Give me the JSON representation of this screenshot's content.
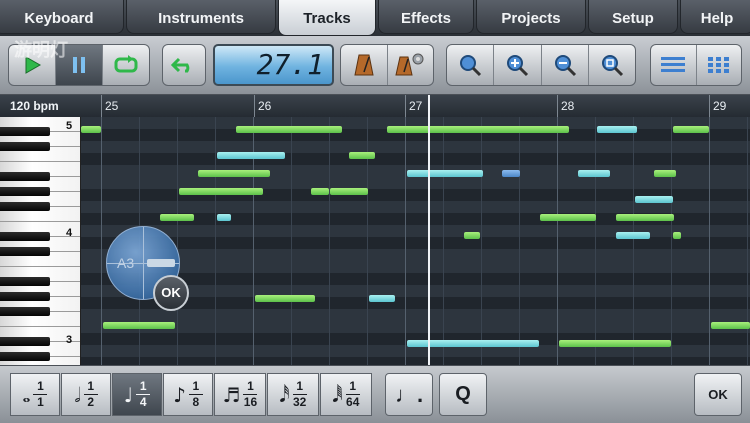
{
  "tabs": [
    {
      "label": "Keyboard",
      "active": false
    },
    {
      "label": "Instruments",
      "active": false
    },
    {
      "label": "Tracks",
      "active": true
    },
    {
      "label": "Effects",
      "active": false
    },
    {
      "label": "Projects",
      "active": false
    },
    {
      "label": "Setup",
      "active": false
    },
    {
      "label": "Help",
      "active": false
    }
  ],
  "watermark": "游明灯",
  "toolbar": {
    "transport": {
      "play_icon": "play-icon",
      "pause_icon": "pause-icon",
      "loop_icon": "loop-icon",
      "active": "pause"
    },
    "undo_icon": "undo-icon",
    "position": "27.1",
    "metronome_icon": "metronome-icon",
    "metronome_settings_icon": "metronome-settings-icon",
    "zoom_icons": [
      "zoom-icon",
      "zoom-in-icon",
      "zoom-out-icon",
      "zoom-fit-icon"
    ],
    "view_icons": [
      "list-view-icon",
      "grid-view-icon"
    ]
  },
  "ruler": {
    "tempo": "120 bpm",
    "bars": [
      "25",
      "26",
      "27",
      "28",
      "29"
    ]
  },
  "keyboard": {
    "octave_labels": [
      "5",
      "4",
      "3"
    ]
  },
  "editor": {
    "selected_note": "A3",
    "ok_label": "OK"
  },
  "durations": [
    {
      "num": "1",
      "den": "1",
      "glyph": "𝅝",
      "selected": false
    },
    {
      "num": "1",
      "den": "2",
      "glyph": "𝅗𝅥",
      "selected": false
    },
    {
      "num": "1",
      "den": "4",
      "glyph": "♩",
      "selected": true
    },
    {
      "num": "1",
      "den": "8",
      "glyph": "♪",
      "selected": false
    },
    {
      "num": "1",
      "den": "16",
      "glyph": "♬",
      "selected": false
    },
    {
      "num": "1",
      "den": "32",
      "glyph": "𝅘𝅥𝅰",
      "selected": false
    },
    {
      "num": "1",
      "den": "64",
      "glyph": "𝅘𝅥𝅱",
      "selected": false
    }
  ],
  "bottom": {
    "dotted_label": "♩.",
    "quantize_label": "Q",
    "ok_label": "OK"
  },
  "colors": {
    "note_green": "#7ee05a",
    "note_cyan": "#7fdde6",
    "note_blue": "#6ea4e0",
    "lcd": "#6fb3e0"
  }
}
